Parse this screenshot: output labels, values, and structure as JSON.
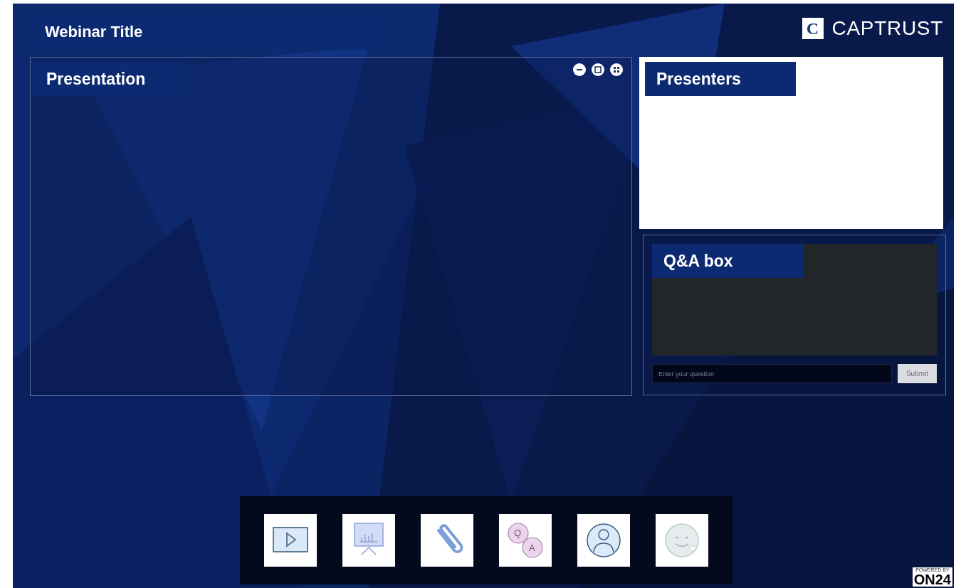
{
  "header": {
    "title": "Webinar Title",
    "logo": {
      "mark": "C",
      "name": "CAPTRUST"
    }
  },
  "presentation": {
    "title": "Presentation",
    "controls": [
      {
        "kind": "minimize"
      },
      {
        "kind": "restore"
      },
      {
        "kind": "fullscreen"
      }
    ]
  },
  "presenters": {
    "title": "Presenters"
  },
  "qa": {
    "title": "Q&A box",
    "input": {
      "placeholder": "Enter your question"
    },
    "submit": "Submit"
  },
  "toolbar": [
    {
      "kind": "video"
    },
    {
      "kind": "slides"
    },
    {
      "kind": "attachment"
    },
    {
      "kind": "qa",
      "q": "Q",
      "a": "A"
    },
    {
      "kind": "profile"
    },
    {
      "kind": "feedback"
    }
  ],
  "footer": {
    "powered": "POWERED BY",
    "brand": "ON24"
  }
}
